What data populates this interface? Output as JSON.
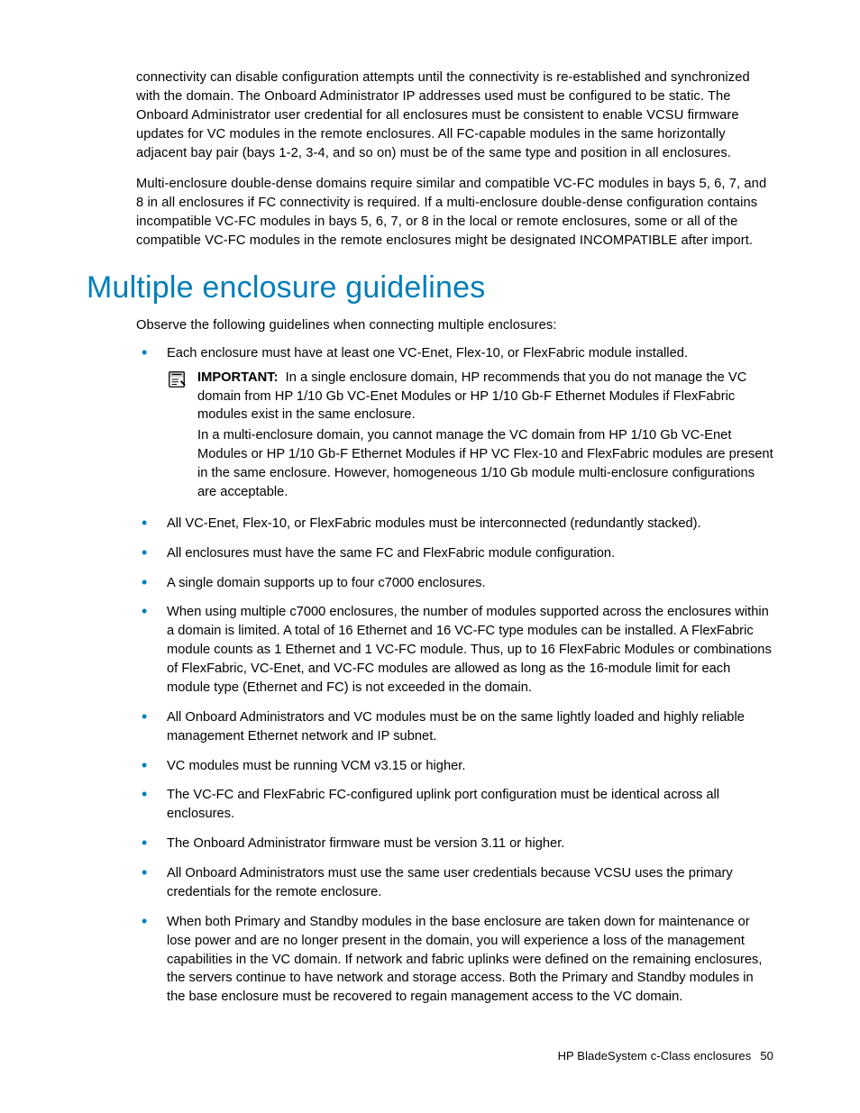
{
  "intro": {
    "p1": "connectivity can disable configuration attempts until the connectivity is re-established and synchronized with the domain. The Onboard Administrator IP addresses used must be configured to be static. The Onboard Administrator user credential for all enclosures must be consistent to enable VCSU firmware updates for VC modules in the remote enclosures. All FC-capable modules in the same horizontally adjacent bay pair (bays 1-2, 3-4, and so on) must be of the same type and position in all enclosures.",
    "p2": "Multi-enclosure double-dense domains require similar and compatible VC-FC modules in bays 5, 6, 7, and 8 in all enclosures if FC connectivity is required. If a multi-enclosure double-dense configuration contains incompatible VC-FC modules in bays 5, 6, 7, or 8 in the local or remote enclosures, some or all of the compatible VC-FC modules in the remote enclosures might be designated INCOMPATIBLE after import."
  },
  "heading": "Multiple enclosure guidelines",
  "lead": "Observe the following guidelines when connecting multiple enclosures:",
  "bullets_a": [
    "Each enclosure must have at least one VC-Enet, Flex-10, or FlexFabric module installed."
  ],
  "callout": {
    "label": "IMPORTANT:",
    "p1": "In a single enclosure domain, HP recommends that you do not manage the VC domain from HP 1/10 Gb VC-Enet Modules or HP 1/10 Gb-F Ethernet Modules if FlexFabric modules exist in the same enclosure.",
    "p2": "In a multi-enclosure domain, you cannot manage the VC domain from HP 1/10 Gb VC-Enet Modules or HP 1/10 Gb-F Ethernet Modules if HP VC Flex-10 and FlexFabric modules are present in the same enclosure. However, homogeneous 1/10 Gb module multi-enclosure configurations are acceptable."
  },
  "bullets_b": [
    "All VC-Enet, Flex-10, or FlexFabric modules must be interconnected (redundantly stacked).",
    "All enclosures must have the same FC and FlexFabric module configuration.",
    "A single domain supports up to four c7000 enclosures.",
    "When using multiple c7000 enclosures, the number of modules supported across the enclosures within a domain is limited. A total of 16 Ethernet and 16 VC-FC type modules can be installed. A FlexFabric module counts as 1 Ethernet and 1 VC-FC module. Thus, up to 16 FlexFabric Modules or combinations of FlexFabric, VC-Enet, and VC-FC modules are allowed as long as the 16-module limit for each module type (Ethernet and FC) is not exceeded in the domain.",
    "All Onboard Administrators and VC modules must be on the same lightly loaded and highly reliable management Ethernet network and IP subnet.",
    "VC modules must be running VCM v3.15 or higher.",
    "The VC-FC and FlexFabric FC-configured uplink port configuration must be identical across all enclosures.",
    "The Onboard Administrator firmware must be version 3.11 or higher.",
    "All Onboard Administrators must use the same user credentials because VCSU uses the primary credentials for the remote enclosure.",
    "When both Primary and Standby modules in the base enclosure are taken down for maintenance or lose power and are no longer present in the domain, you will experience a loss of the management capabilities in the VC domain. If network and fabric uplinks were defined on the remaining enclosures, the servers continue to have network and storage access. Both the Primary and Standby modules in the base enclosure must be recovered to regain management access to the VC domain."
  ],
  "footer": {
    "title": "HP BladeSystem c-Class enclosures",
    "page": "50"
  }
}
